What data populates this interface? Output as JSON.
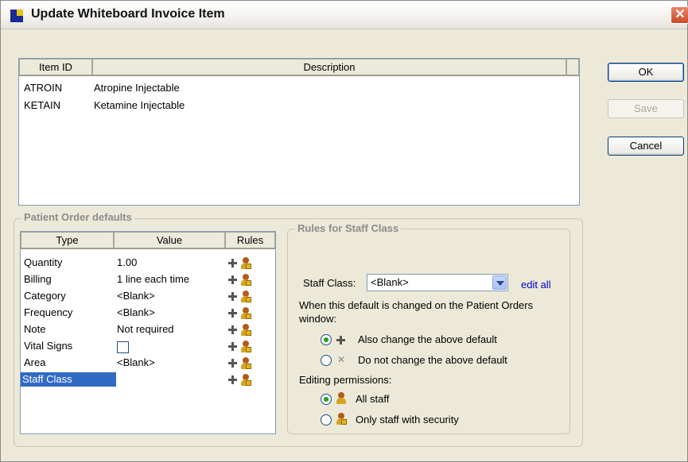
{
  "window": {
    "title": "Update Whiteboard Invoice Item"
  },
  "buttons": {
    "ok": "OK",
    "save": "Save",
    "cancel": "Cancel"
  },
  "items_list": {
    "columns": [
      "Item ID",
      "Description"
    ],
    "rows": [
      {
        "id": "ATROIN",
        "description": "Atropine Injectable"
      },
      {
        "id": "KETAIN",
        "description": "Ketamine Injectable"
      }
    ]
  },
  "patient_order_defaults": {
    "label": "Patient Order defaults",
    "columns": [
      "Type",
      "Value",
      "Rules"
    ],
    "rows": [
      {
        "type": "Quantity",
        "value": "1.00"
      },
      {
        "type": "Billing",
        "value": "1 line each time"
      },
      {
        "type": "Category",
        "value": "<Blank>"
      },
      {
        "type": "Frequency",
        "value": "<Blank>"
      },
      {
        "type": "Note",
        "value": "Not required"
      },
      {
        "type": "Vital Signs",
        "value": ""
      },
      {
        "type": "Area",
        "value": "<Blank>"
      },
      {
        "type": "Staff Class",
        "value": ""
      }
    ]
  },
  "rules": {
    "label": "Rules for Staff Class",
    "staff_class_label": "Staff Class:",
    "staff_class_value": "<Blank>",
    "edit_all": "edit all",
    "when_changed_line1": "When this default is changed on the Patient Orders",
    "when_changed_line2": "window:",
    "also_change": "Also change the above default",
    "do_not_change": "Do not change the above default",
    "editing_permissions": "Editing permissions:",
    "all_staff": "All staff",
    "only_security": "Only staff with security"
  },
  "colors": {
    "selection": "#316ac5",
    "link": "#0000cc",
    "radio_dot": "#21a121"
  }
}
